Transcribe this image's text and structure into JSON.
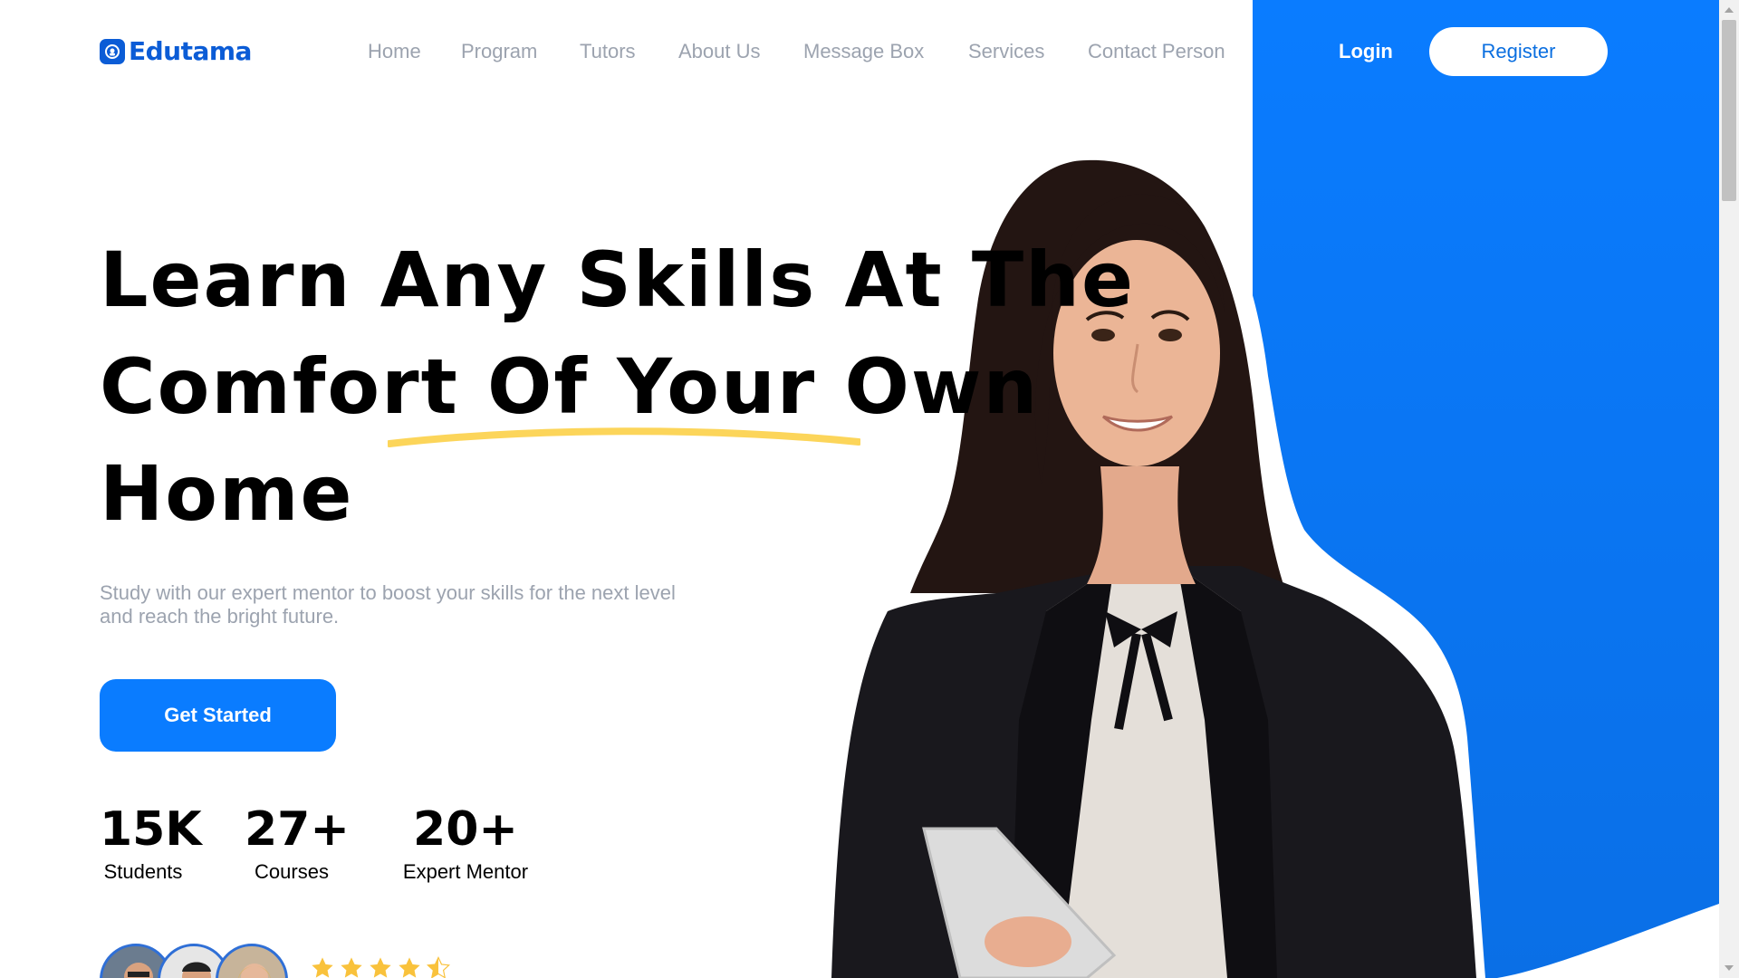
{
  "brand": {
    "name": "Edutama",
    "color": "#0b5cd6",
    "icon": "logo-badge-icon"
  },
  "nav": {
    "items": [
      {
        "label": "Home"
      },
      {
        "label": "Program"
      },
      {
        "label": "Tutors"
      },
      {
        "label": "About Us"
      },
      {
        "label": "Message Box"
      },
      {
        "label": "Services"
      },
      {
        "label": "Contact Person"
      }
    ]
  },
  "auth": {
    "login_label": "Login",
    "register_label": "Register"
  },
  "hero": {
    "headline_lines": [
      "Learn Any Skills At The",
      "Comfort Of Your Own",
      "Home"
    ],
    "subtitle": "Study with our expert mentor to boost your skills for the next level and reach the bright future.",
    "cta_label": "Get Started"
  },
  "stats": [
    {
      "value": "15K",
      "label": "Students"
    },
    {
      "value": "27+",
      "label": "Courses"
    },
    {
      "value": "20+",
      "label": "Expert Mentor"
    }
  ],
  "rating": {
    "stars": 4.5,
    "max": 5
  },
  "colors": {
    "accent_blue": "#0a7cff",
    "panel_blue_top": "#0a7cff",
    "panel_blue_bottom": "#0a6fe6",
    "underline_yellow": "#fcd55a",
    "star_yellow": "#f9c23c",
    "muted_text": "#9ca3af"
  }
}
